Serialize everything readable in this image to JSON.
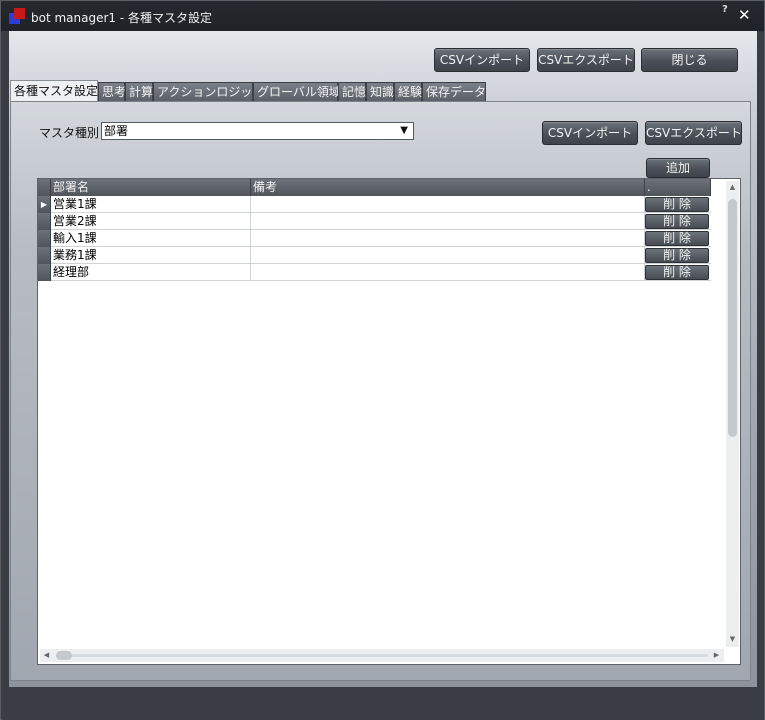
{
  "window": {
    "title": "bot manager1 - 各種マスタ設定",
    "help_glyph": "?",
    "close_glyph": "✕",
    "app_icon": "app-logo-icon",
    "accent_color": "#2b3fd6",
    "secondary_color": "#c81818"
  },
  "toolbar": {
    "csv_import": "CSVインポート",
    "csv_export": "CSVエクスポート",
    "close": "閉じる"
  },
  "tabs": [
    {
      "label": "各種マスタ設定",
      "active": true
    },
    {
      "label": "思考",
      "active": false
    },
    {
      "label": "計算",
      "active": false
    },
    {
      "label": "アクションロジック",
      "active": false
    },
    {
      "label": "グローバル領域",
      "active": false
    },
    {
      "label": "記憶",
      "active": false
    },
    {
      "label": "知識",
      "active": false
    },
    {
      "label": "経験",
      "active": false
    },
    {
      "label": "保存データ",
      "active": false
    }
  ],
  "master": {
    "label": "マスタ種別",
    "selected": "部署",
    "dropdown_glyph": "▼",
    "csv_import": "CSVインポート",
    "csv_export": "CSVエクスポート",
    "add": "追加"
  },
  "grid": {
    "columns": [
      "部署名",
      "備考",
      "."
    ],
    "current_row_marker": "▶",
    "delete_label": "削 除",
    "rows": [
      {
        "name": "営業1課",
        "note": ""
      },
      {
        "name": "営業2課",
        "note": ""
      },
      {
        "name": "輸入1課",
        "note": ""
      },
      {
        "name": "業務1課",
        "note": ""
      },
      {
        "name": "経理部",
        "note": ""
      }
    ],
    "scroll_up": "▲",
    "scroll_down": "▼",
    "scroll_left": "◀",
    "scroll_right": "▶"
  }
}
